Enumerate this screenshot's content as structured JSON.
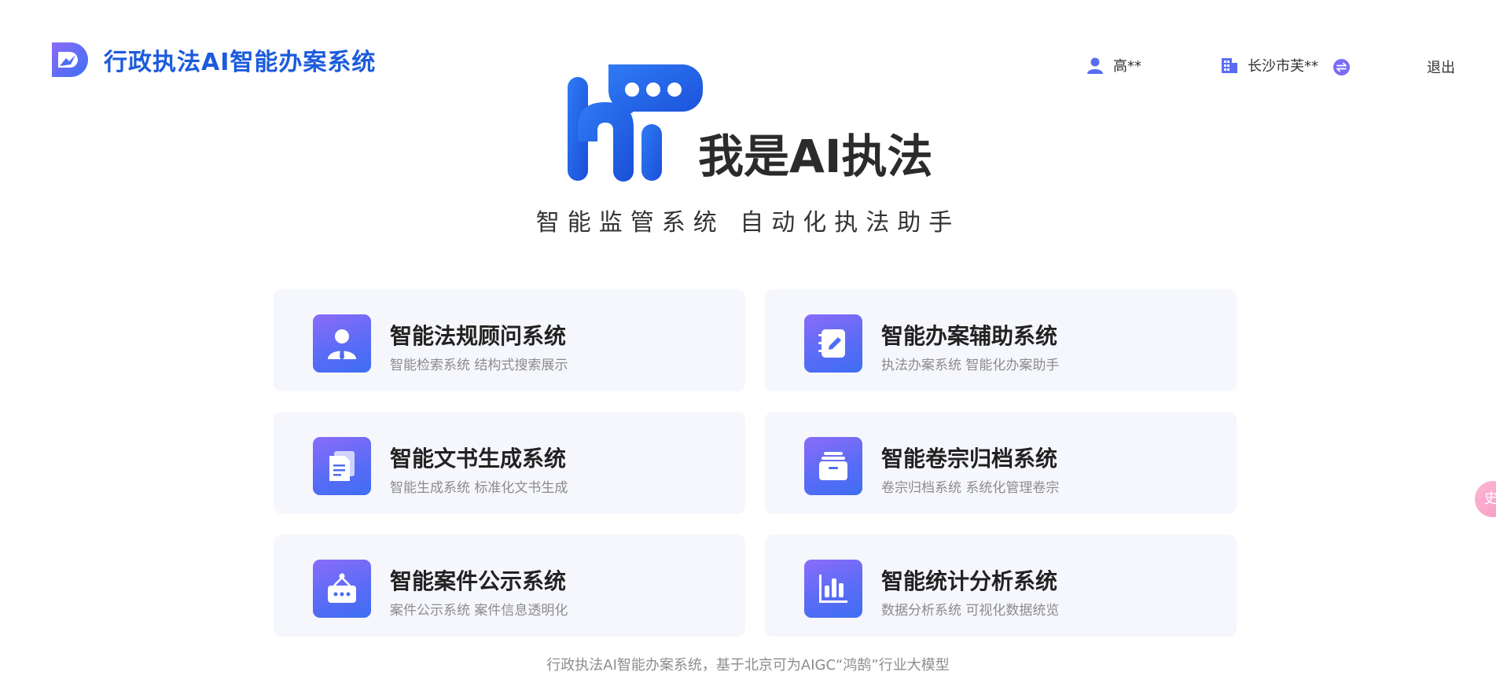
{
  "header": {
    "app_title": "行政执法AI智能办案系统",
    "user_name": "高**",
    "org_name": "长沙市芙**",
    "logout_label": "退出"
  },
  "hero": {
    "logo_text": "hi",
    "title": "我是AI执法",
    "subtitle": "智能监管系统 自动化执法助手"
  },
  "cards": [
    {
      "title": "智能法规顾问系统",
      "desc": "智能检索系统 结构式搜索展示",
      "icon": "user-suit-icon"
    },
    {
      "title": "智能办案辅助系统",
      "desc": "执法办案系统 智能化办案助手",
      "icon": "notebook-pen-icon"
    },
    {
      "title": "智能文书生成系统",
      "desc": "智能生成系统 标准化文书生成",
      "icon": "document-icon"
    },
    {
      "title": "智能卷宗归档系统",
      "desc": "卷宗归档系统 系统化管理卷宗",
      "icon": "archive-box-icon"
    },
    {
      "title": "智能案件公示系统",
      "desc": "案件公示系统 案件信息透明化",
      "icon": "notice-board-icon"
    },
    {
      "title": "智能统计分析系统",
      "desc": "数据分析系统 可视化数据统览",
      "icon": "bar-chart-icon"
    }
  ],
  "footer": {
    "text": "行政执法AI智能办案系统，基于北京可为AIGC“鸿鹄”行业大模型"
  },
  "float_button": {
    "label": "史"
  },
  "colors": {
    "brand_blue": "#1c5bdc",
    "icon_gradient_start": "#8a6cfa",
    "icon_gradient_end": "#3d6ef2",
    "card_bg": "#f6f7fc"
  }
}
